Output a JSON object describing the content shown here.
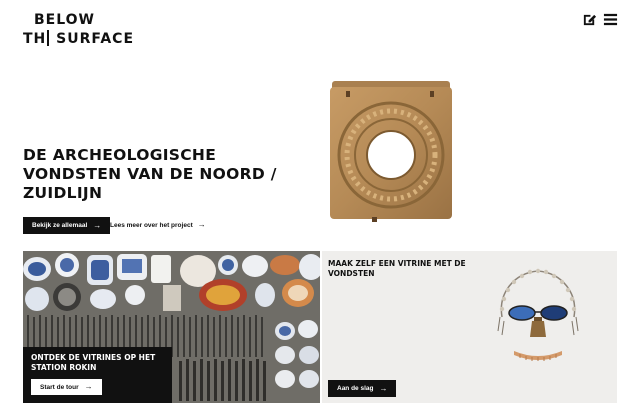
{
  "header": {
    "logo_line1": "BELOW",
    "logo_line2_a": "TH",
    "logo_line2_b": " SURFACE",
    "icons": [
      "edit-icon",
      "menu-icon"
    ]
  },
  "hero": {
    "title": "De archeologische vondsten van de Noord / Zuidlijn",
    "primary_button": "Bekijk ze allemaal",
    "secondary_link": "Lees meer over het project"
  },
  "cards": {
    "tour": {
      "title": "Ontdek de vitrines op het station Rokin",
      "button": "Start de tour"
    },
    "create": {
      "title": "Maak zelf een vitrine met de vondsten",
      "button": "Aan de slag"
    }
  },
  "colors": {
    "text": "#111111",
    "panel_grey": "#efeeec",
    "wood": "#b58a56",
    "tour_bg": "#6f6d67"
  }
}
